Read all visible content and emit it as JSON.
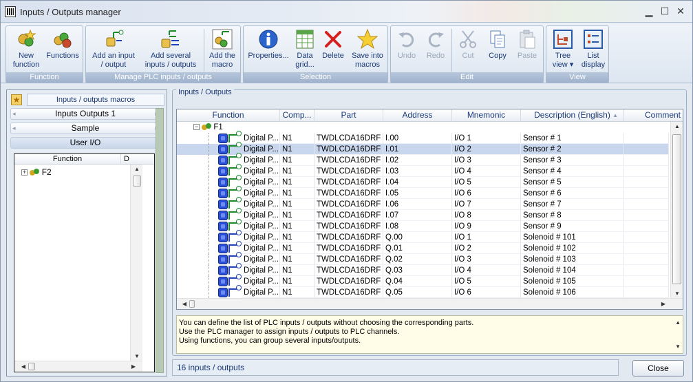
{
  "window": {
    "title": "Inputs / Outputs manager",
    "minimize": "▁",
    "maximize": "☐",
    "close": "✕"
  },
  "ribbon": {
    "groups": {
      "function": "Function",
      "manage": "Manage PLC inputs / outputs",
      "selection": "Selection",
      "edit": "Edit",
      "view": "View"
    },
    "buttons": {
      "new_function": [
        "New",
        "function"
      ],
      "functions": [
        "Functions",
        ""
      ],
      "add_io": [
        "Add an input",
        "/ output"
      ],
      "add_several": [
        "Add several",
        "inputs / outputs"
      ],
      "add_macro": [
        "Add the",
        "macro"
      ],
      "properties": [
        "Properties...",
        ""
      ],
      "data_grid": [
        "Data",
        "grid..."
      ],
      "delete": [
        "Delete",
        ""
      ],
      "save_macros": [
        "Save into",
        "macros"
      ],
      "undo": [
        "Undo",
        ""
      ],
      "redo": [
        "Redo",
        ""
      ],
      "cut": [
        "Cut",
        ""
      ],
      "copy": [
        "Copy",
        ""
      ],
      "paste": [
        "Paste",
        ""
      ],
      "tree_view": [
        "Tree",
        "view ▾"
      ],
      "list_display": [
        "List",
        "display"
      ]
    }
  },
  "left_panel": {
    "title": "Inputs / outputs macros",
    "tabs": [
      "Inputs Outputs 1",
      "Sample",
      "User I/O"
    ],
    "tree_header": [
      "Function",
      "D"
    ],
    "tree_items": [
      {
        "expander": "+",
        "label": "F2"
      }
    ]
  },
  "right_panel": {
    "title": "Inputs / Outputs",
    "columns": [
      "Function",
      "Comp...",
      "Part",
      "Address",
      "Mnemonic",
      "Description (English)",
      "Comment ("
    ],
    "group": {
      "expander": "−",
      "label": "F1"
    },
    "rows": [
      {
        "type": "in",
        "function": "Digital P...",
        "comp": "N1",
        "part": "TWDLCDA16DRF",
        "address": "I.00",
        "mnemonic": "I/O 1",
        "description": "Sensor # 1",
        "selected": false
      },
      {
        "type": "in",
        "function": "Digital P...",
        "comp": "N1",
        "part": "TWDLCDA16DRF",
        "address": "I.01",
        "mnemonic": "I/O 2",
        "description": "Sensor # 2",
        "selected": true
      },
      {
        "type": "in",
        "function": "Digital P...",
        "comp": "N1",
        "part": "TWDLCDA16DRF",
        "address": "I.02",
        "mnemonic": "I/O 3",
        "description": "Sensor # 3",
        "selected": false
      },
      {
        "type": "in",
        "function": "Digital P...",
        "comp": "N1",
        "part": "TWDLCDA16DRF",
        "address": "I.03",
        "mnemonic": "I/O 4",
        "description": "Sensor # 4",
        "selected": false
      },
      {
        "type": "in",
        "function": "Digital P...",
        "comp": "N1",
        "part": "TWDLCDA16DRF",
        "address": "I.04",
        "mnemonic": "I/O 5",
        "description": "Sensor # 5",
        "selected": false
      },
      {
        "type": "in",
        "function": "Digital P...",
        "comp": "N1",
        "part": "TWDLCDA16DRF",
        "address": "I.05",
        "mnemonic": "I/O 6",
        "description": "Sensor # 6",
        "selected": false
      },
      {
        "type": "in",
        "function": "Digital P...",
        "comp": "N1",
        "part": "TWDLCDA16DRF",
        "address": "I.06",
        "mnemonic": "I/O 7",
        "description": "Sensor # 7",
        "selected": false
      },
      {
        "type": "in",
        "function": "Digital P...",
        "comp": "N1",
        "part": "TWDLCDA16DRF",
        "address": "I.07",
        "mnemonic": "I/O 8",
        "description": "Sensor # 8",
        "selected": false
      },
      {
        "type": "in",
        "function": "Digital P...",
        "comp": "N1",
        "part": "TWDLCDA16DRF",
        "address": "I.08",
        "mnemonic": "I/O 9",
        "description": "Sensor # 9",
        "selected": false
      },
      {
        "type": "out",
        "function": "Digital P...",
        "comp": "N1",
        "part": "TWDLCDA16DRF",
        "address": "Q.00",
        "mnemonic": "I/O 1",
        "description": "Solenoid # 101",
        "selected": false
      },
      {
        "type": "out",
        "function": "Digital P...",
        "comp": "N1",
        "part": "TWDLCDA16DRF",
        "address": "Q.01",
        "mnemonic": "I/O 2",
        "description": "Solenoid # 102",
        "selected": false
      },
      {
        "type": "out",
        "function": "Digital P...",
        "comp": "N1",
        "part": "TWDLCDA16DRF",
        "address": "Q.02",
        "mnemonic": "I/O 3",
        "description": "Solenoid # 103",
        "selected": false
      },
      {
        "type": "out",
        "function": "Digital P...",
        "comp": "N1",
        "part": "TWDLCDA16DRF",
        "address": "Q.03",
        "mnemonic": "I/O 4",
        "description": "Solenoid # 104",
        "selected": false
      },
      {
        "type": "out",
        "function": "Digital P...",
        "comp": "N1",
        "part": "TWDLCDA16DRF",
        "address": "Q.04",
        "mnemonic": "I/O 5",
        "description": "Solenoid # 105",
        "selected": false
      },
      {
        "type": "out",
        "function": "Digital P...",
        "comp": "N1",
        "part": "TWDLCDA16DRF",
        "address": "Q.05",
        "mnemonic": "I/O 6",
        "description": "Solenoid # 106",
        "selected": false
      }
    ],
    "info_lines": [
      "You can define the list of PLC inputs / outputs without choosing the corresponding parts.",
      "Use the PLC manager to assign inputs / outputs to PLC channels.",
      "Using functions, you can group several inputs/outputs."
    ]
  },
  "status": {
    "text": "16 inputs / outputs"
  },
  "close_button": "Close",
  "colors": {
    "accent": "#1b3a78",
    "selection": "#c9d7ee",
    "info_bg": "#fffde8"
  }
}
